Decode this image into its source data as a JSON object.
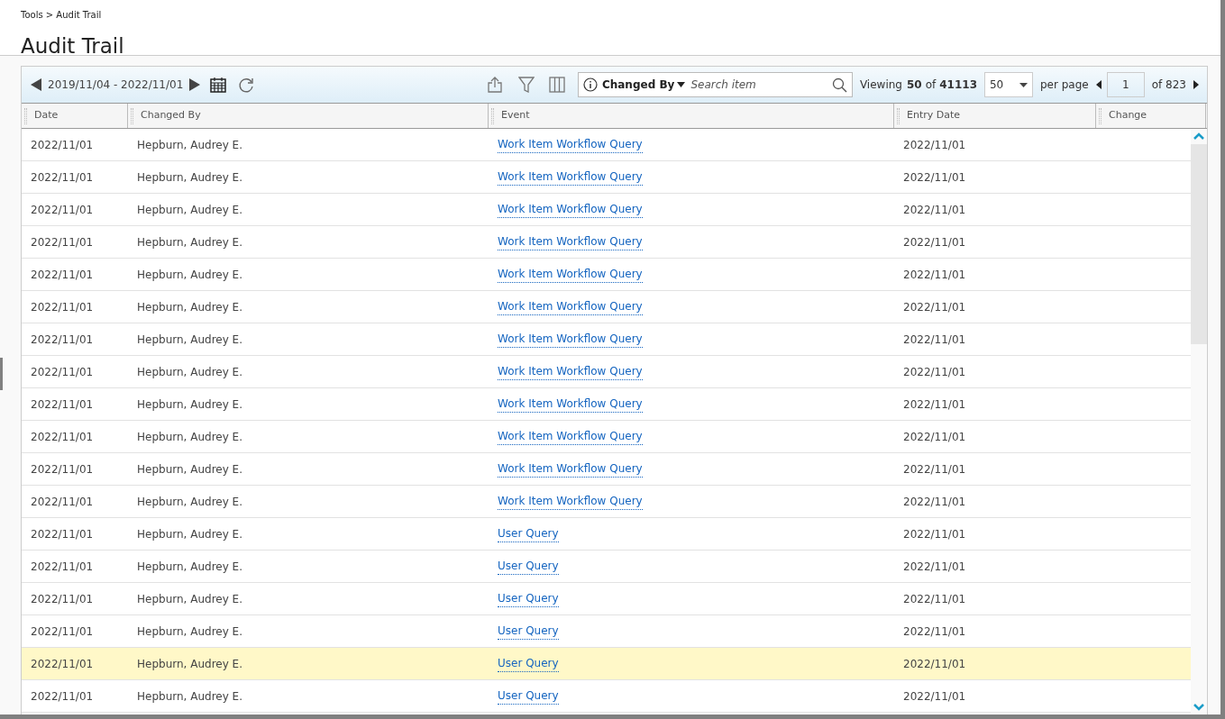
{
  "breadcrumb": "Tools > Audit Trail",
  "title": "Audit Trail",
  "toolbar": {
    "date_range": "2019/11/04 - 2022/11/01",
    "search_field": "Changed By",
    "search_placeholder": "Search item",
    "viewing_label": "Viewing",
    "viewing_count": "50",
    "viewing_of": "of",
    "viewing_total": "41113",
    "page_size": "50",
    "per_page": "per page",
    "page": "1",
    "page_of": "of 823"
  },
  "table": {
    "columns": [
      "Date",
      "Changed By",
      "Event",
      "Entry Date",
      "Change"
    ],
    "rows": [
      {
        "date": "2022/11/01",
        "changed_by": "Hepburn, Audrey E.",
        "event": "Work Item Workflow Query",
        "entry_date": "2022/11/01",
        "highlighted": false
      },
      {
        "date": "2022/11/01",
        "changed_by": "Hepburn, Audrey E.",
        "event": "Work Item Workflow Query",
        "entry_date": "2022/11/01",
        "highlighted": false
      },
      {
        "date": "2022/11/01",
        "changed_by": "Hepburn, Audrey E.",
        "event": "Work Item Workflow Query",
        "entry_date": "2022/11/01",
        "highlighted": false
      },
      {
        "date": "2022/11/01",
        "changed_by": "Hepburn, Audrey E.",
        "event": "Work Item Workflow Query",
        "entry_date": "2022/11/01",
        "highlighted": false
      },
      {
        "date": "2022/11/01",
        "changed_by": "Hepburn, Audrey E.",
        "event": "Work Item Workflow Query",
        "entry_date": "2022/11/01",
        "highlighted": false
      },
      {
        "date": "2022/11/01",
        "changed_by": "Hepburn, Audrey E.",
        "event": "Work Item Workflow Query",
        "entry_date": "2022/11/01",
        "highlighted": false
      },
      {
        "date": "2022/11/01",
        "changed_by": "Hepburn, Audrey E.",
        "event": "Work Item Workflow Query",
        "entry_date": "2022/11/01",
        "highlighted": false
      },
      {
        "date": "2022/11/01",
        "changed_by": "Hepburn, Audrey E.",
        "event": "Work Item Workflow Query",
        "entry_date": "2022/11/01",
        "highlighted": false
      },
      {
        "date": "2022/11/01",
        "changed_by": "Hepburn, Audrey E.",
        "event": "Work Item Workflow Query",
        "entry_date": "2022/11/01",
        "highlighted": false
      },
      {
        "date": "2022/11/01",
        "changed_by": "Hepburn, Audrey E.",
        "event": "Work Item Workflow Query",
        "entry_date": "2022/11/01",
        "highlighted": false
      },
      {
        "date": "2022/11/01",
        "changed_by": "Hepburn, Audrey E.",
        "event": "Work Item Workflow Query",
        "entry_date": "2022/11/01",
        "highlighted": false
      },
      {
        "date": "2022/11/01",
        "changed_by": "Hepburn, Audrey E.",
        "event": "Work Item Workflow Query",
        "entry_date": "2022/11/01",
        "highlighted": false
      },
      {
        "date": "2022/11/01",
        "changed_by": "Hepburn, Audrey E.",
        "event": "User Query",
        "entry_date": "2022/11/01",
        "highlighted": false
      },
      {
        "date": "2022/11/01",
        "changed_by": "Hepburn, Audrey E.",
        "event": "User Query",
        "entry_date": "2022/11/01",
        "highlighted": false
      },
      {
        "date": "2022/11/01",
        "changed_by": "Hepburn, Audrey E.",
        "event": "User Query",
        "entry_date": "2022/11/01",
        "highlighted": false
      },
      {
        "date": "2022/11/01",
        "changed_by": "Hepburn, Audrey E.",
        "event": "User Query",
        "entry_date": "2022/11/01",
        "highlighted": false
      },
      {
        "date": "2022/11/01",
        "changed_by": "Hepburn, Audrey E.",
        "event": "User Query",
        "entry_date": "2022/11/01",
        "highlighted": true
      },
      {
        "date": "2022/11/01",
        "changed_by": "Hepburn, Audrey E.",
        "event": "User Query",
        "entry_date": "2022/11/01",
        "highlighted": false
      }
    ]
  }
}
